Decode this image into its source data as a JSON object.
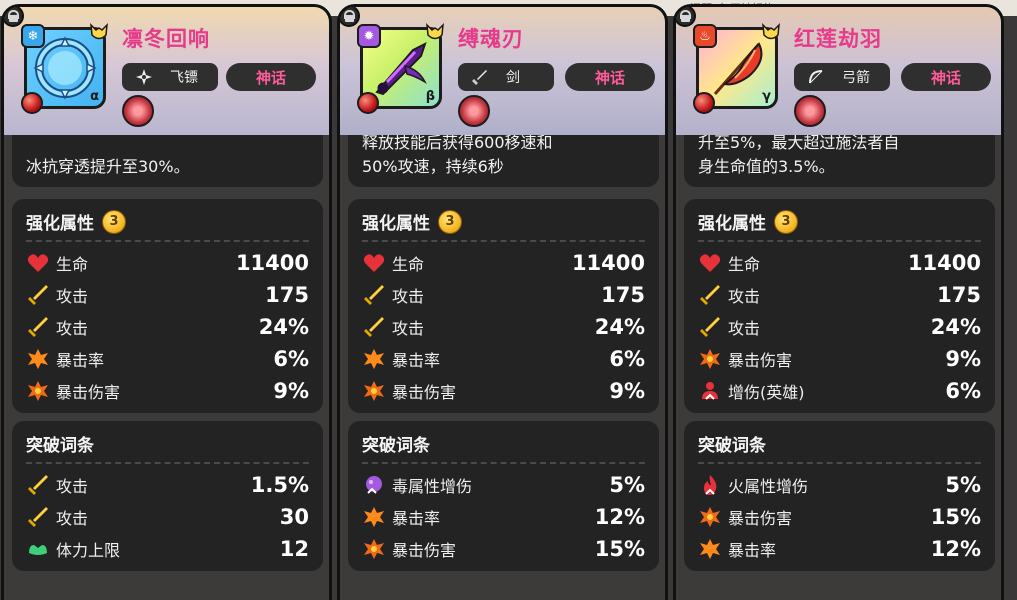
{
  "top_strip_text": "问题, 每天被好礼",
  "cards": [
    {
      "name": "凛冬回响",
      "type_label": "飞镖",
      "type_icon": "shuriken-icon",
      "rarity": "神话",
      "greek": "α",
      "element_icon": "snowflake-icon",
      "desc_line1": "",
      "desc_line2": "冰抗穿透提升至30%。",
      "enhance_title": "强化属性",
      "enhance_level": "3",
      "enhance": [
        {
          "icon": "heart-icon",
          "label": "生命",
          "value": "11400"
        },
        {
          "icon": "sword-icon",
          "label": "攻击",
          "value": "175"
        },
        {
          "icon": "sword-icon",
          "label": "攻击",
          "value": "24%"
        },
        {
          "icon": "crit-burst-icon",
          "label": "暴击率",
          "value": "6%"
        },
        {
          "icon": "crit-damage-icon",
          "label": "暴击伤害",
          "value": "9%"
        }
      ],
      "break_title": "突破词条",
      "breaks": [
        {
          "icon": "sword-icon",
          "label": "攻击",
          "value": "1.5%"
        },
        {
          "icon": "sword-icon",
          "label": "攻击",
          "value": "30"
        },
        {
          "icon": "stamina-icon",
          "label": "体力上限",
          "value": "12"
        }
      ]
    },
    {
      "name": "缚魂刃",
      "type_label": "剑",
      "type_icon": "sword-type-icon",
      "rarity": "神话",
      "greek": "β",
      "element_icon": "poison-icon",
      "desc_line1": "释放技能后获得600移速和",
      "desc_line2": "50%攻速，持续6秒",
      "enhance_title": "强化属性",
      "enhance_level": "3",
      "enhance": [
        {
          "icon": "heart-icon",
          "label": "生命",
          "value": "11400"
        },
        {
          "icon": "sword-icon",
          "label": "攻击",
          "value": "175"
        },
        {
          "icon": "sword-icon",
          "label": "攻击",
          "value": "24%"
        },
        {
          "icon": "crit-burst-icon",
          "label": "暴击率",
          "value": "6%"
        },
        {
          "icon": "crit-damage-icon",
          "label": "暴击伤害",
          "value": "9%"
        }
      ],
      "break_title": "突破词条",
      "breaks": [
        {
          "icon": "poison-dmg-icon",
          "label": "毒属性增伤",
          "value": "5%"
        },
        {
          "icon": "crit-burst-icon",
          "label": "暴击率",
          "value": "12%"
        },
        {
          "icon": "crit-damage-icon",
          "label": "暴击伤害",
          "value": "15%"
        }
      ]
    },
    {
      "name": "红莲劫羽",
      "type_label": "弓箭",
      "type_icon": "bow-icon",
      "rarity": "神话",
      "greek": "γ",
      "element_icon": "fire-icon",
      "desc_line1": "升至5%，最大超过施法者自",
      "desc_line2": "身生命值的3.5%。",
      "enhance_title": "强化属性",
      "enhance_level": "3",
      "enhance": [
        {
          "icon": "heart-icon",
          "label": "生命",
          "value": "11400"
        },
        {
          "icon": "sword-icon",
          "label": "攻击",
          "value": "175"
        },
        {
          "icon": "sword-icon",
          "label": "攻击",
          "value": "24%"
        },
        {
          "icon": "crit-damage-icon",
          "label": "暴击伤害",
          "value": "9%"
        },
        {
          "icon": "hero-dmg-icon",
          "label": "增伤(英雄)",
          "value": "6%"
        }
      ],
      "break_title": "突破词条",
      "breaks": [
        {
          "icon": "fire-dmg-icon",
          "label": "火属性增伤",
          "value": "5%"
        },
        {
          "icon": "crit-damage-icon",
          "label": "暴击伤害",
          "value": "15%"
        },
        {
          "icon": "crit-burst-icon",
          "label": "暴击率",
          "value": "12%"
        }
      ]
    }
  ]
}
